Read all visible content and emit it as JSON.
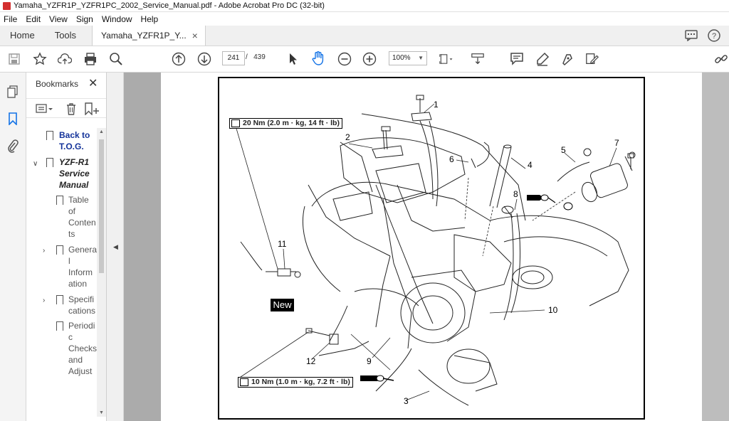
{
  "window": {
    "title": "Yamaha_YZFR1P_YZFR1PC_2002_Service_Manual.pdf - Adobe Acrobat Pro DC (32-bit)"
  },
  "menu": [
    "File",
    "Edit",
    "View",
    "Sign",
    "Window",
    "Help"
  ],
  "tabs": {
    "home": "Home",
    "tools": "Tools",
    "document": "Yamaha_YZFR1P_Y...",
    "close_glyph": "×"
  },
  "toolbar": {
    "current_page": "241",
    "page_separator": "/",
    "total_pages": "439",
    "zoom": "100%"
  },
  "bookmarks": {
    "header": "Bookmarks",
    "close_glyph": "✕",
    "items": [
      {
        "label": "Back to\nT.O.G.",
        "style": "link"
      },
      {
        "label": "YZF-R1\nService\nManual",
        "style": "italic-bold",
        "expanded": true
      },
      {
        "label": "Table\nof\nConten\nts"
      },
      {
        "label": "Genera\nl\nInform\nation",
        "collapsed": true
      },
      {
        "label": "Specifi\ncations",
        "collapsed": true
      },
      {
        "label": "Periodi\nc\nChecks\nand\nAdjust"
      }
    ]
  },
  "diagram": {
    "torque_top": "20 Nm (2.0 m · kg, 14 ft · lb)",
    "torque_bottom": "10 Nm (1.0 m · kg, 7.2 ft · lb)",
    "new_label": "New",
    "callouts": [
      "1",
      "2",
      "3",
      "4",
      "5",
      "6",
      "7",
      "8",
      "9",
      "10",
      "11",
      "12"
    ]
  }
}
